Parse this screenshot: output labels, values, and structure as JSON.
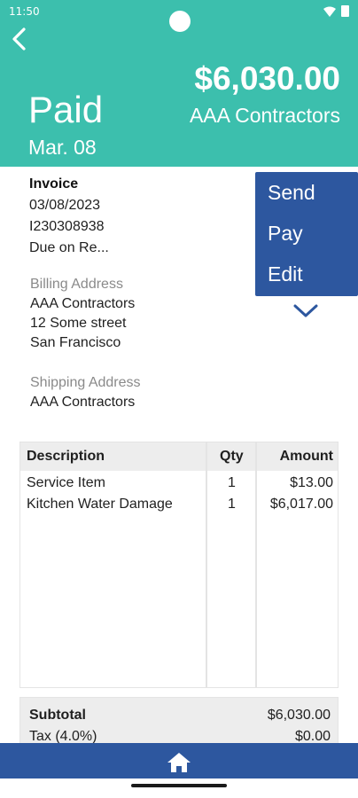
{
  "status_bar": {
    "time": "11:50"
  },
  "header": {
    "amount": "$6,030.00",
    "vendor": "AAA Contractors",
    "status": "Paid",
    "date": "Mar. 08"
  },
  "invoice": {
    "title": "Invoice",
    "date": "03/08/2023",
    "number": "I230308938",
    "terms": "Due on Re..."
  },
  "billing": {
    "label": "Billing Address",
    "lines": [
      "AAA Contractors",
      "12 Some street",
      "San Francisco"
    ]
  },
  "shipping": {
    "label": "Shipping Address",
    "lines": [
      "AAA Contractors"
    ]
  },
  "actions": [
    "Send",
    "Pay",
    "Edit"
  ],
  "table": {
    "headers": {
      "description": "Description",
      "qty": "Qty",
      "amount": "Amount"
    },
    "rows": [
      {
        "description": "Service Item",
        "qty": "1",
        "amount": "$13.00"
      },
      {
        "description": "Kitchen Water Damage",
        "qty": "1",
        "amount": "$6,017.00"
      }
    ]
  },
  "totals": {
    "subtotal_label": "Subtotal",
    "subtotal_value": "$6,030.00",
    "tax_label": "Tax (4.0%)",
    "tax_value": "$0.00"
  },
  "colors": {
    "header_bg": "#3cbfad",
    "accent_blue": "#2d579f"
  },
  "icons": {
    "back": "chevron-left-icon",
    "collapse": "chevron-down-icon",
    "home": "home-icon"
  }
}
